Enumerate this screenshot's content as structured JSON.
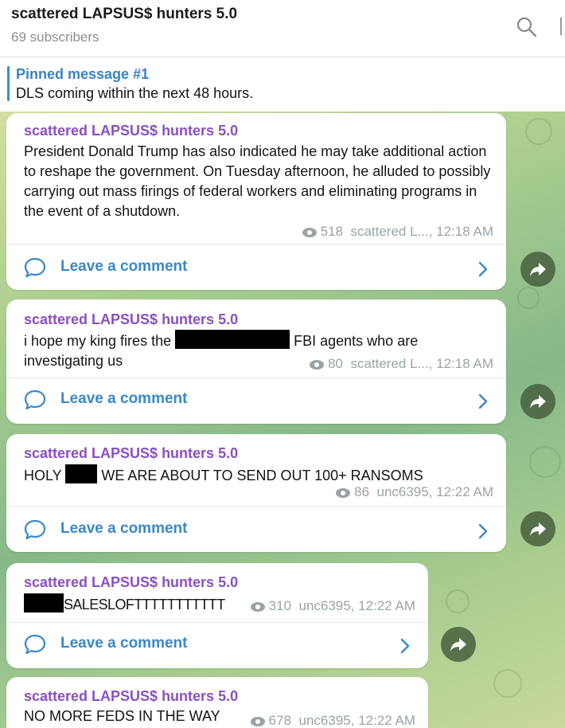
{
  "header": {
    "title": "scattered LAPSUS$ hunters 5.0",
    "subscribers": "69 subscribers",
    "search_icon": "search-icon"
  },
  "pinned": {
    "title": "Pinned message #1",
    "text": "DLS coming within the next 48 hours."
  },
  "colors": {
    "sender": "#8a4fc1",
    "link": "#3a88c8",
    "meta": "#9aa3a7",
    "pinned_bar": "#3a8fd6"
  },
  "messages": [
    {
      "sender": "scattered LAPSUS$ hunters 5.0",
      "text": "President Donald Trump has also indicated he may take additional action to reshape the government. On Tuesday afternoon, he alluded to possibly carrying out mass firings of federal workers and eliminating programs in the event of a shutdown.",
      "views": "518",
      "author": "scattered L...,",
      "time": "12:18 AM",
      "comment_label": "Leave a comment"
    },
    {
      "sender": "scattered LAPSUS$ hunters 5.0",
      "text_before": "i hope my king fires the",
      "text_after": "FBI agents who are",
      "text_line2": "investigating us",
      "views": "80",
      "author": "scattered L...,",
      "time": "12:18 AM",
      "comment_label": "Leave a comment"
    },
    {
      "sender": "scattered LAPSUS$ hunters 5.0",
      "text_before": "HOLY",
      "text_after": "WE ARE ABOUT TO SEND OUT 100+ RANSOMS",
      "views": "86",
      "author": "unc6395,",
      "time": "12:22 AM",
      "comment_label": "Leave a comment"
    },
    {
      "sender": "scattered LAPSUS$ hunters 5.0",
      "text_after": "SALESLOFTTTTTTTTTTT",
      "views": "310",
      "author": "unc6395,",
      "time": "12:22 AM",
      "comment_label": "Leave a comment"
    },
    {
      "sender": "scattered LAPSUS$ hunters 5.0",
      "text": "NO MORE FEDS IN THE WAY",
      "views": "678",
      "author": "unc6395,",
      "time": "12:22 AM"
    }
  ]
}
